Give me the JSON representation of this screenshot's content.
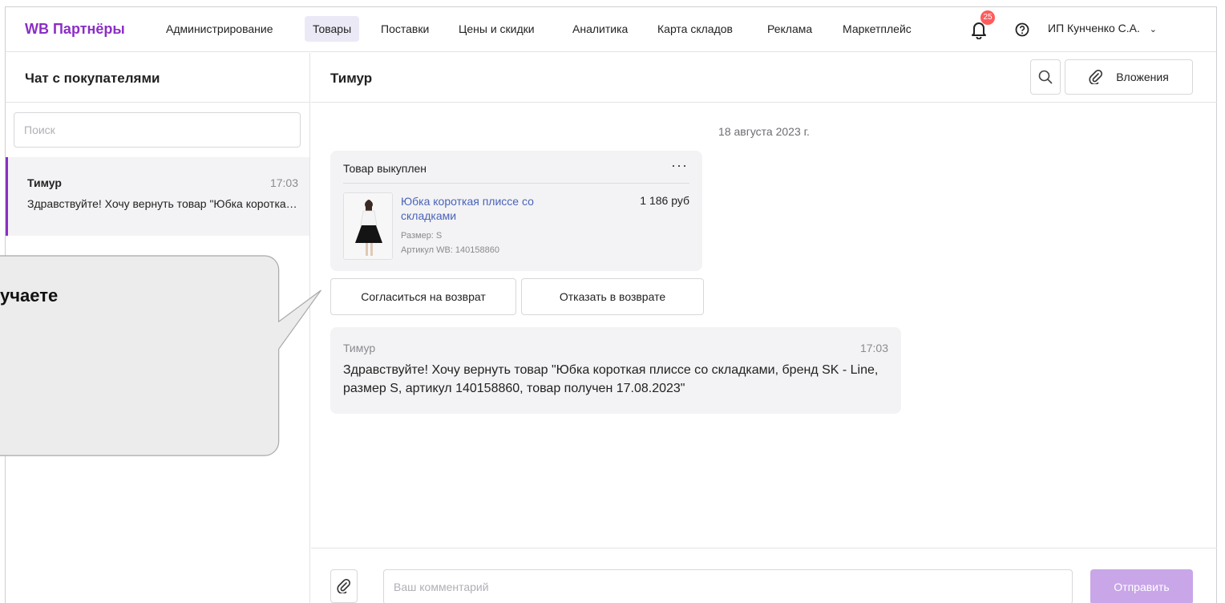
{
  "brand": {
    "logo": "WB Партнёры",
    "accent": "#8b2ec5"
  },
  "nav": {
    "items": [
      {
        "label": "Администрирование",
        "active": false
      },
      {
        "label": "Товары",
        "active": true
      },
      {
        "label": "Поставки",
        "active": false
      },
      {
        "label": "Цены и скидки",
        "active": false
      },
      {
        "label": "Аналитика",
        "active": false
      },
      {
        "label": "Карта складов",
        "active": false
      },
      {
        "label": "Реклама",
        "active": false
      },
      {
        "label": "Маркетплейс",
        "active": false
      }
    ],
    "notifications_count": "25",
    "user": "ИП Кунченко С.А."
  },
  "sidebar": {
    "title": "Чат с покупателями",
    "search_placeholder": "Поиск",
    "chats": [
      {
        "name": "Тимур",
        "time": "17:03",
        "preview": "Здравствуйте! Хочу вернуть товар \"Юбка короткая плиссе со складками\""
      }
    ]
  },
  "chat": {
    "title": "Тимур",
    "attachments_label": "Вложения",
    "date": "18 августа 2023 г.",
    "order": {
      "status": "Товар выкуплен",
      "product_name": "Юбка короткая плиссе со складками",
      "price": "1 186 руб",
      "size": "Размер: S",
      "article": "Артикул WB: 140158860"
    },
    "actions": {
      "accept": "Согласиться на возврат",
      "decline": "Отказать в возврате"
    },
    "message": {
      "author": "Тимур",
      "time": "17:03",
      "text": "Здравствуйте! Хочу вернуть товар \"Юбка короткая плиссе со складками, бренд SK - Line, размер S, артикул 140158860, товар получен 17.08.2023\""
    },
    "composer": {
      "placeholder": "Ваш комментарий",
      "send_label": "Отправить"
    }
  },
  "callout": {
    "text": "учаете"
  }
}
